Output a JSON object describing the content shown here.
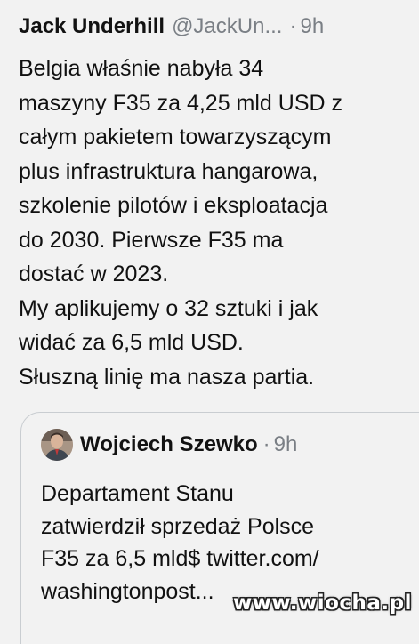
{
  "tweet": {
    "author_name": "Jack Underhill",
    "author_handle": "@JackUn...",
    "separator": "·",
    "time": "9h",
    "lines": [
      "Belgia właśnie nabyła 34",
      "maszyny F35 za 4,25 mld USD z",
      "całym pakietem towarzyszącym",
      "plus infrastruktura hangarowa,",
      "szkolenie pilotów i eksploatacja",
      "do 2030. Pierwsze F35 ma",
      "dostać w 2023.",
      "My aplikujemy o 32 sztuki i jak",
      "widać za 6,5 mld USD.",
      "Słuszną linię ma nasza partia."
    ]
  },
  "quoted_tweet": {
    "author_name": "Wojciech Szewko",
    "separator": "·",
    "time": "9h",
    "avatar_icon": "profile-photo-icon",
    "lines": [
      "Departament Stanu",
      "zatwierdził sprzedaż Polsce",
      "F35 za 6,5 mld$ twitter.com/",
      "washingtonpost..."
    ]
  },
  "watermark": {
    "text": "www.wiocha.pl"
  },
  "colors": {
    "background": "#f2f2f2",
    "text": "#111111",
    "muted": "#7a7f85",
    "border": "#c9cdd1"
  }
}
